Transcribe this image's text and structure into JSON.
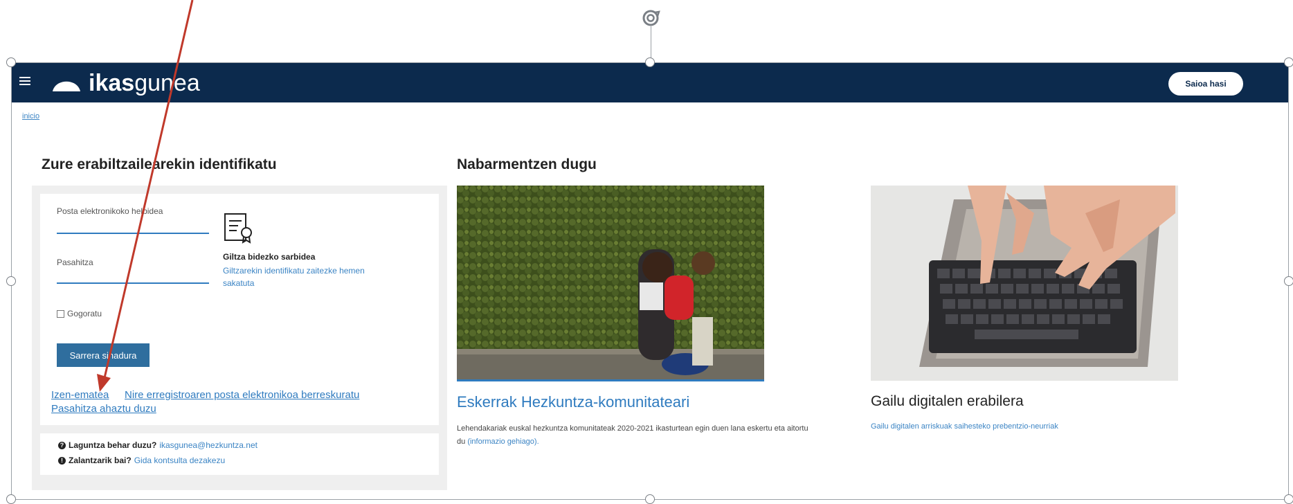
{
  "header": {
    "logo_bold": "ikas",
    "logo_light": "gunea",
    "login_button": "Saioa hasi"
  },
  "breadcrumb": "inicio",
  "login": {
    "heading": "Zure erabiltzailearekin identifikatu",
    "email_label": "Posta elektronikoko helbidea",
    "email_value": "",
    "password_label": "Pasahitza",
    "password_value": "",
    "remember_label": "Gogoratu",
    "submit_label": "Sarrera sinadura",
    "key_access_title": "Giltza bidezko sarbidea",
    "key_access_link": "Giltzarekin identifikatu zaitezke hemen sakatuta",
    "register_link": "Izen-ematea",
    "recover_email_link": "Nire erregistroaren posta elektronikoa berreskuratu",
    "forgot_password_link": "Pasahitza ahaztu duzu"
  },
  "help": {
    "help_question": "Laguntza behar duzu?",
    "help_email": "ikasgunea@hezkuntza.net",
    "doubts_question": "Zalantzarik bai?",
    "doubts_link": "Gida kontsulta dezakezu"
  },
  "featured": {
    "heading": "Nabarmentzen dugu",
    "cards": [
      {
        "title": "Eskerrak Hezkuntza-komunitateari",
        "description": "Lehendakariak euskal hezkuntza komunitateak 2020-2021 ikasturtean egin duen lana eskertu eta aitortu du",
        "link": "(informazio gehiago)."
      },
      {
        "title": "Gailu digitalen erabilera",
        "link": "Gailu digitalen arriskuak saihesteko prebentzio-neurriak"
      }
    ]
  },
  "colors": {
    "topbar": "#0c2a4d",
    "accent": "#2f7bbf",
    "annotation_arrow": "#c0392b"
  }
}
